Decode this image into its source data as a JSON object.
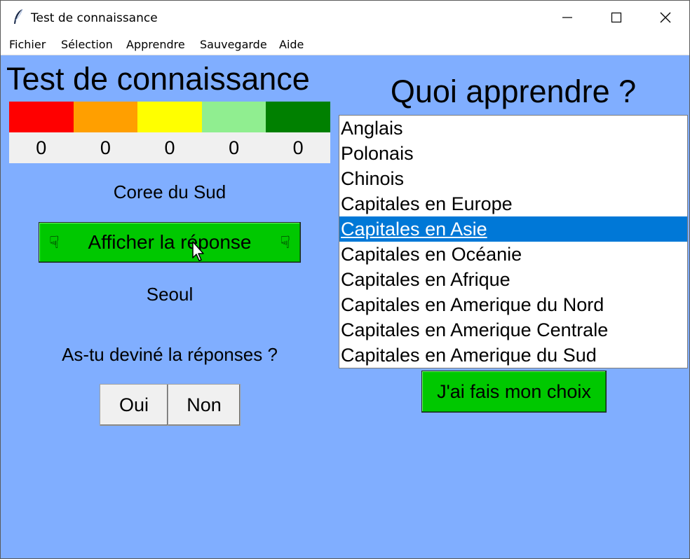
{
  "window": {
    "title": "Test de connaissance",
    "icon": "feather-icon",
    "controls": [
      "minimize-icon",
      "maximize-icon",
      "close-icon"
    ]
  },
  "menu": [
    "Fichier",
    "Sélection",
    "Apprendre",
    "Sauvegarde",
    "Aide"
  ],
  "left_panel": {
    "title": "Test de connaissance",
    "score_colors": [
      "#ff0000",
      "#ff9f00",
      "#ffff00",
      "#90ee90",
      "#008000"
    ],
    "scores": [
      "0",
      "0",
      "0",
      "0",
      "0"
    ],
    "question": "Coree du Sud",
    "show_answer_label": "Afficher la réponse",
    "answer": "Seoul",
    "guess_prompt": "As-tu deviné la réponses ?",
    "yes_label": "Oui",
    "no_label": "Non"
  },
  "right_panel": {
    "title": "Quoi apprendre ?",
    "topics": [
      "Anglais",
      "Polonais",
      "Chinois",
      "Capitales en Europe",
      "Capitales en Asie",
      "Capitales en Océanie",
      "Capitales en Afrique",
      "Capitales en Amerique du Nord",
      "Capitales en Amerique Centrale",
      "Capitales en Amerique du Sud"
    ],
    "selected_topic": "Capitales en Asie",
    "choice_label": "J'ai fais mon choix"
  },
  "colors": {
    "background": "#80aeff",
    "button_green": "#00c800",
    "selection_blue": "#0078d7"
  }
}
